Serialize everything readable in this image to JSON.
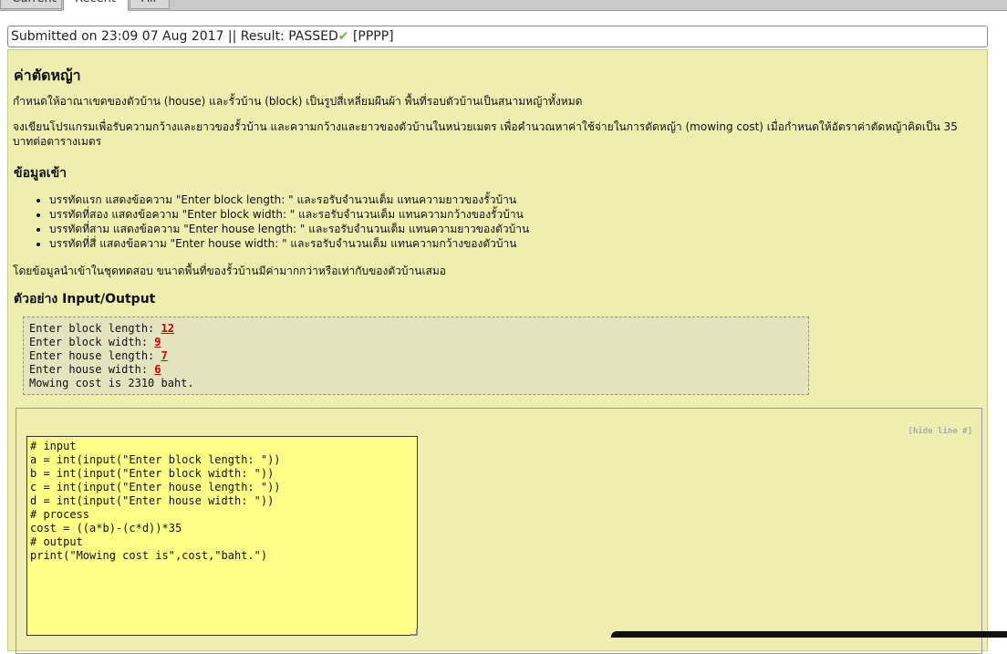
{
  "tabs": [
    {
      "label": "Current"
    },
    {
      "label": "Recent"
    },
    {
      "label": "All"
    }
  ],
  "submission": {
    "text": "Submitted on 23:09 07 Aug 2017 || Result: PASSED",
    "grade": "[PPPP]"
  },
  "problem": {
    "title": "ค่าตัดหญ้า",
    "desc1": "กำหนดให้อาณาเขตของตัวบ้าน (house) และรั้วบ้าน (block) เป็นรูปสี่เหลี่ยมผืนผ้า พื้นที่รอบตัวบ้านเป็นสนามหญ้าทั้งหมด",
    "desc2a": "จงเขียนโปรแกรมเพื่อรับความกว้างและยาวของรั้วบ้าน และความกว้างและยาวของตัวบ้านในหน่วยเมตร เพื่อคำนวณหาค่าใช้จ่ายในการตัดหญ้า (mowing cost) เมื่อกำหนดให้อัตราค่าตัดหญ้าคิดเป็น 35",
    "desc2b": "บาทต่อตารางเมตร",
    "input_heading": "ข้อมูลเข้า",
    "input_items": [
      "บรรทัดแรก แสดงข้อความ \"Enter block length: \" และรอรับจำนวนเต็ม แทนความยาวของรั้วบ้าน",
      "บรรทัดที่สอง แสดงข้อความ \"Enter block width: \" และรอรับจำนวนเต็ม แทนความกว้างของรั้วบ้าน",
      "บรรทัดที่สาม แสดงข้อความ \"Enter house length: \" และรอรับจำนวนเต็ม แทนความยาวของตัวบ้าน",
      "บรรทัดที่สี่ แสดงข้อความ \"Enter house width: \" และรอรับจำนวนเต็ม แทนความกว้างของตัวบ้าน"
    ],
    "constraint": "โดยข้อมูลนำเข้าในชุดทดสอบ ขนาดพื้นที่ของรั้วบ้านมีค่ามากกว่าหรือเท่ากับของตัวบ้านเสมอ",
    "example_heading": "ตัวอย่าง Input/Output"
  },
  "sample": [
    {
      "prompt": "Enter block length: ",
      "value": "12"
    },
    {
      "prompt": "Enter block width: ",
      "value": "9"
    },
    {
      "prompt": "Enter house length: ",
      "value": "7"
    },
    {
      "prompt": "Enter house width: ",
      "value": "6"
    },
    {
      "prompt": "Mowing cost is 2310 baht.",
      "value": ""
    }
  ],
  "code": {
    "hide_line": "[hide line #]",
    "source": "# input\na = int(input(\"Enter block length: \"))\nb = int(input(\"Enter block width: \"))\nc = int(input(\"Enter house length: \"))\nd = int(input(\"Enter house width: \"))\n# process\ncost = ((a*b)-(c*d))*35\n# output\nprint(\"Mowing cost is\",cost,\"baht.\")"
  },
  "colors": {
    "problem_bg": "#eeeeb0",
    "code_bg": "#ffff88",
    "passed_check": "#7cae45",
    "input_value": "#cc0000"
  }
}
